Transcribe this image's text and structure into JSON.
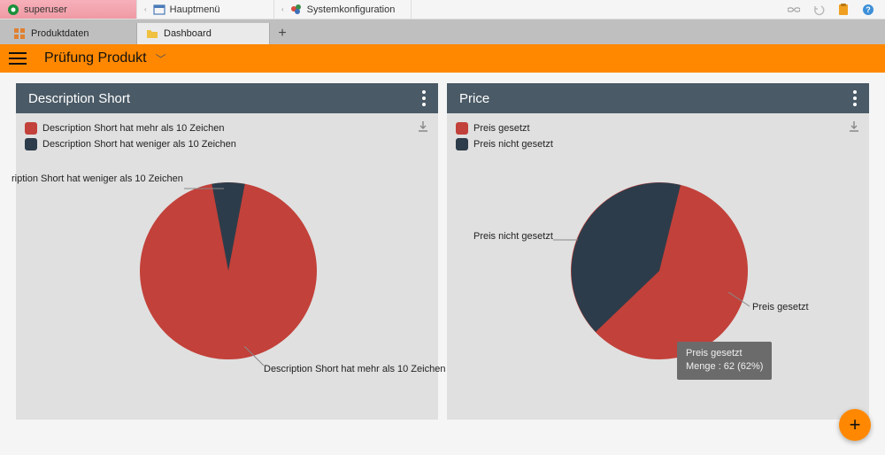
{
  "menubar": {
    "superuser": "superuser",
    "mainmenu": "Hauptmenü",
    "syscfg": "Systemkonfiguration"
  },
  "tabs": {
    "tab1": "Produktdaten",
    "tab2": "Dashboard"
  },
  "header": {
    "title": "Prüfung Produkt"
  },
  "cards": {
    "desc": {
      "title": "Description Short",
      "legend_more": "Description Short hat mehr als 10 Zeichen",
      "legend_less": "Description Short hat weniger als 10 Zeichen",
      "label_more": "Description Short hat mehr als 10 Zeichen",
      "label_less": "ription Short hat weniger als 10 Zeichen"
    },
    "price": {
      "title": "Price",
      "legend_set": "Preis gesetzt",
      "legend_notset": "Preis nicht gesetzt",
      "label_set": "Preis gesetzt",
      "label_notset": "Preis nicht gesetzt",
      "tooltip_title": "Preis gesetzt",
      "tooltip_value": "Menge : 62 (62%)"
    }
  },
  "chart_data": [
    {
      "type": "pie",
      "title": "Description Short",
      "series": [
        {
          "name": "Description Short hat mehr als 10 Zeichen",
          "value": 94,
          "color": "#c2413a"
        },
        {
          "name": "Description Short hat weniger als 10 Zeichen",
          "value": 6,
          "color": "#2d3c4a"
        }
      ]
    },
    {
      "type": "pie",
      "title": "Price",
      "series": [
        {
          "name": "Preis gesetzt",
          "value": 62,
          "color": "#c2413a"
        },
        {
          "name": "Preis nicht gesetzt",
          "value": 38,
          "color": "#2d3c4a"
        }
      ]
    }
  ]
}
